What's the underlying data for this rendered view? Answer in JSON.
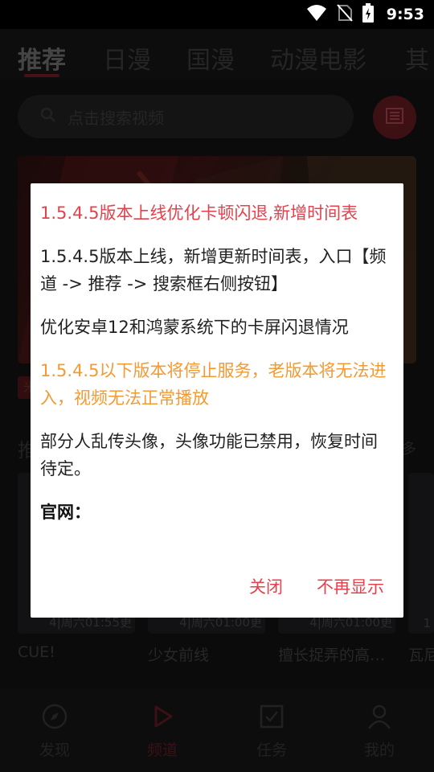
{
  "status_bar": {
    "time": "9:53"
  },
  "tabs": [
    {
      "label": "推荐"
    },
    {
      "label": "日漫"
    },
    {
      "label": "国漫"
    },
    {
      "label": "动漫电影"
    },
    {
      "label": "其"
    }
  ],
  "search": {
    "placeholder": "点击搜索视频"
  },
  "banner": {
    "tag": "米"
  },
  "section": {
    "title": "推",
    "more": "多"
  },
  "cards": [
    {
      "title": "CUE!",
      "badge": "4|周六01:55更"
    },
    {
      "title": "少女前线",
      "badge": "4|周六01:00更"
    },
    {
      "title": "擅长捉弄的高…",
      "badge": "4|周六01:00更"
    },
    {
      "title": "瓦尼",
      "badge": "1"
    }
  ],
  "bottom_nav": [
    {
      "label": "发现",
      "icon": "compass-icon"
    },
    {
      "label": "频道",
      "icon": "play-icon"
    },
    {
      "label": "任务",
      "icon": "task-icon"
    },
    {
      "label": "我的",
      "icon": "user-icon"
    }
  ],
  "dialog": {
    "headline": "1.5.4.5版本上线优化卡顿闪退,新增时间表",
    "para1": "1.5.4.5版本上线，新增更新时间表，入口【频道 -> 推荐 -> 搜索框右侧按钮】",
    "para2": "优化安卓12和鸿蒙系统下的卡屏闪退情况",
    "warning": "1.5.4.5以下版本将停止服务，老版本将无法进入，视频无法正常播放",
    "para3": "部分人乱传头像，头像功能已禁用，恢复时间待定。",
    "website_label": "官网：",
    "close_label": "关闭",
    "dont_show_label": "不再显示"
  },
  "colors": {
    "accent": "#e4414d",
    "warning": "#f39a33"
  }
}
